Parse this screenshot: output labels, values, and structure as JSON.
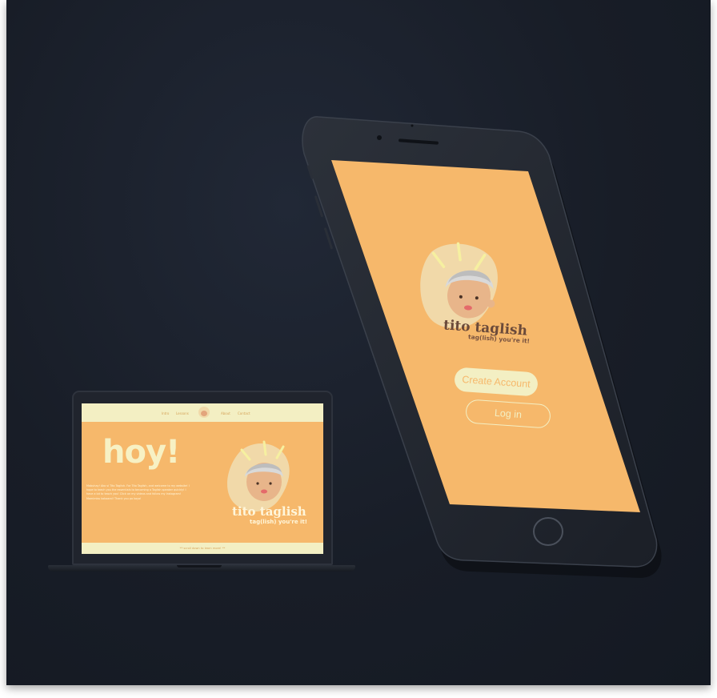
{
  "laptop": {
    "nav": {
      "items": [
        "Intro",
        "Lessons",
        "About",
        "Contact"
      ]
    },
    "hero_title": "hoy!",
    "intro_text": "Mabuhay! Ako si Tito Taglish. For Tito Taglish, and welcome to my website! I hope to teach you the essentials to becoming a Taglish speaker quickly! I have a lot to teach you! Click on my videos and follow my Instagram! Mamimiss kakaaral! Thank you po kayo!",
    "footer_text": "** scroll down to learn more! **",
    "brand_title": "tito taglish",
    "brand_tagline": "tag(lish) you're it!"
  },
  "phone": {
    "brand_title": "tito taglish",
    "brand_tagline": "tag(lish) you're it!",
    "create_account_label": "Create Account",
    "login_label": "Log in"
  },
  "colors": {
    "background": "#181d27",
    "brand_orange": "#f6b86b",
    "brand_cream": "#f3efc3",
    "brand_brown": "#6b4a3a",
    "device_body": "#20242d"
  },
  "icons": [
    "tito-avatar-icon",
    "camera-icon",
    "speaker-icon",
    "home-button-icon"
  ]
}
